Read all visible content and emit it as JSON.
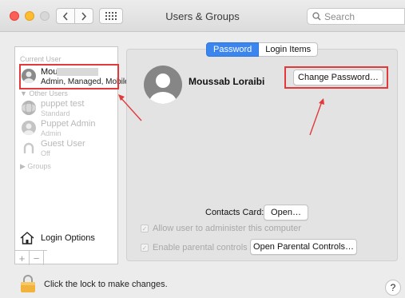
{
  "window": {
    "title": "Users & Groups",
    "search_placeholder": "Search",
    "nav_back_icon": "chevron-left-icon",
    "nav_forward_icon": "chevron-right-icon",
    "grid_icon": "grid-icon"
  },
  "sidebar": {
    "current_user_section": "Current User",
    "current_user": {
      "name": "Mou",
      "subtitle": "Admin, Managed, Mobile"
    },
    "other_users_section": "Other Users",
    "other_users": [
      {
        "name": "puppet test",
        "subtitle": "Standard"
      },
      {
        "name": "Puppet Admin",
        "subtitle": "Admin"
      },
      {
        "name": "Guest User",
        "subtitle": "Off"
      }
    ],
    "groups_label": "Groups",
    "login_options_label": "Login Options",
    "add_label": "+",
    "remove_label": "−"
  },
  "main": {
    "tabs": [
      {
        "label": "Password",
        "active": true
      },
      {
        "label": "Login Items",
        "active": false
      }
    ],
    "full_name": "Moussab Loraibi",
    "change_password_button": "Change Password…",
    "contacts_card_label": "Contacts Card:",
    "contacts_open_button": "Open…",
    "allow_admin_label": "Allow user to administer this computer",
    "allow_admin_checked": true,
    "parental_controls_label": "Enable parental controls",
    "parental_controls_checked": true,
    "open_parental_controls_button": "Open Parental Controls…"
  },
  "footer": {
    "lock_text": "Click the lock to make changes.",
    "help_label": "?"
  },
  "colors": {
    "accent": "#3b86ee",
    "annotation_red": "#e23a3a"
  }
}
